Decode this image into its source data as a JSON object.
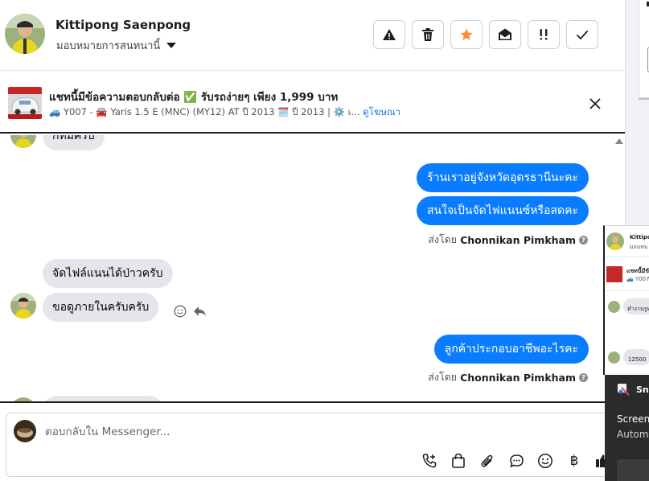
{
  "header": {
    "contact_name": "Kittipong Saenpong",
    "assign_label": "มอบหมายการสนทนานี้",
    "toolbar": [
      {
        "name": "spam-button",
        "icon": "warning-icon"
      },
      {
        "name": "delete-button",
        "icon": "trash-icon"
      },
      {
        "name": "star-button",
        "icon": "star-icon"
      },
      {
        "name": "mark-unread-button",
        "icon": "envelope-open-icon"
      },
      {
        "name": "follow-up-button",
        "icon": "double-exclamation-icon"
      },
      {
        "name": "mark-done-button",
        "icon": "check-icon"
      }
    ],
    "star_color": "#f7923a"
  },
  "ad": {
    "title": "แชทนี้มีข้อความตอบกลับต่อ ✅ รับรถง่ายๆ เพียง 1,999 บาท",
    "subtitle": "🚙 Y007 - 🚘 Yaris 1.5 E (MNC) (MY12) AT ปี 2013 🗓️ ปี 2013 | ⚙️ เ...",
    "link_label": "ดูโฆษณา"
  },
  "thread": {
    "messages": [
      {
        "dir": "in",
        "text": "ก็ทีมครับ"
      },
      {
        "dir": "out",
        "text": "ร้านเราอยู่จังหวัดอุดรธานีนะคะ"
      },
      {
        "dir": "out",
        "text": "สนใจเป็นจัดไฟแนนซ์หรือสดคะ"
      },
      {
        "dir": "in",
        "text": "จัดไฟล์แนนได้ป่าวครับ"
      },
      {
        "dir": "in",
        "text": "ขอดูภายในครับครับ"
      },
      {
        "dir": "out",
        "text": "ลูกค้าประกอบอาชีพอะไรคะ"
      }
    ],
    "sent_by_prefix": "ส่งโดย",
    "sent_by_name": "Chonnikan Pimkham",
    "help_glyph": "?",
    "bubble_out_color": "#0a7cff",
    "bubble_in_color": "#e4e6eb"
  },
  "composer": {
    "placeholder": "ตอบกลับใน Messenger...",
    "tools": [
      "call-icon",
      "bag-icon",
      "paperclip-icon",
      "chat-bubble-icon",
      "emoji-icon",
      "baht-icon",
      "thumbs-up-icon"
    ],
    "baht_glyph": "฿"
  },
  "mini_chat": {
    "name": "Kittipo",
    "sub": "มอบหม",
    "ad_line1": "แชทนี้มีข้",
    "ad_line2": "🚙 Y007 -",
    "msg1": "ทำงานรูทก",
    "msg2": "12500"
  },
  "snip": {
    "title": "Sni",
    "heading": "Screen",
    "sub": "Autom"
  }
}
